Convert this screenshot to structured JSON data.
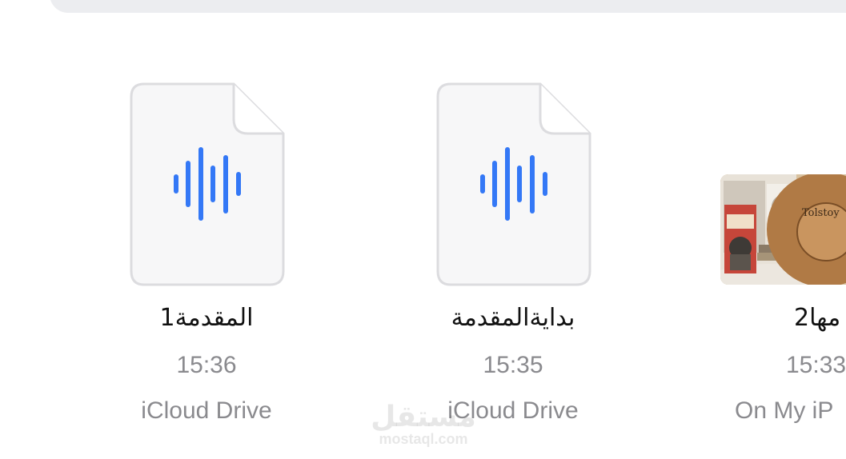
{
  "files": [
    {
      "name": "المقدمة1",
      "time": "15:36",
      "location": "iCloud Drive",
      "thumbnail_icon": "audio-waveform-icon"
    },
    {
      "name": "بدايةالمقدمة",
      "time": "15:35",
      "location": "iCloud Drive",
      "thumbnail_icon": "audio-waveform-icon"
    },
    {
      "name": "مها2",
      "time": "15:33",
      "location": "On My iP",
      "thumbnail_icon": "book-cover-photo"
    }
  ],
  "colors": {
    "waveform": "#3478f6",
    "search_bar": "#ecedf0",
    "secondary_text": "#8a8a8e"
  },
  "watermark": {
    "mark": "مستقل",
    "url": "mostaql.com"
  }
}
